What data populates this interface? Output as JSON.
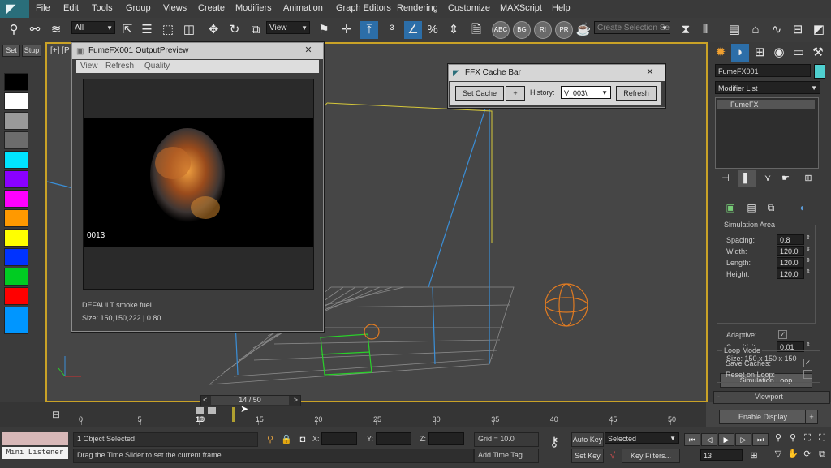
{
  "menubar": {
    "items": [
      "File",
      "Edit",
      "Tools",
      "Group",
      "Views",
      "Create",
      "Modifiers",
      "Animation",
      "Graph Editors",
      "Rendering",
      "Customize",
      "MAXScript",
      "Help"
    ]
  },
  "toolbar": {
    "selection_filter": "All",
    "ref_coord": "View",
    "selection_set_placeholder": "Create Selection Se",
    "render_icons": [
      "ABC",
      "BG",
      "RI",
      "PR",
      "SE"
    ]
  },
  "left_strip": {
    "tab_set": "Set",
    "tab_stup": "Stup",
    "swatches": [
      "#000000",
      "#ffffff",
      "#9a9a9a",
      "#6c6c6c",
      "#00e5ff",
      "#8a00ff",
      "#ff00ff",
      "#ff9900",
      "#ffff00",
      "#0033ff",
      "#00cc22",
      "#ff0000",
      "#0096ff"
    ]
  },
  "viewport": {
    "label": "[+] [P"
  },
  "preview_window": {
    "title": "FumeFX001 OutputPreview",
    "menu": [
      "View",
      "Refresh",
      "Quality"
    ],
    "frame_number": "0013",
    "info_line1": "DEFAULT smoke fuel",
    "info_line2": "Size: 150,150,222 | 0.80"
  },
  "cache_bar": {
    "title": "FFX Cache Bar",
    "set_cache": "Set Cache",
    "plus": "+",
    "history_label": "History:",
    "history_value": "V_003\\",
    "refresh": "Refresh"
  },
  "command_panel": {
    "object_name": "FumeFX001",
    "object_color": "#4fd0d0",
    "modifier_list": "Modifier List",
    "stack_item": "FumeFX",
    "simulation_area_title": "Simulation Area",
    "params": [
      {
        "label": "Spacing:",
        "value": "0.8"
      },
      {
        "label": "Width:",
        "value": "120.0"
      },
      {
        "label": "Length:",
        "value": "120.0"
      },
      {
        "label": "Height:",
        "value": "120.0"
      }
    ],
    "adaptive_label": "Adaptive:",
    "adaptive_checked": true,
    "sensitivity_label": "Sensitivity:",
    "sensitivity_value": "0.01",
    "size_line": "Size: 150 x 150 x 150",
    "simulation_loop": "Simulation Loop",
    "loop_mode_title": "Loop Mode",
    "save_caches": "Save Caches:",
    "reset_on_loop": "Reset on Loop:",
    "viewport_section": "Viewport",
    "enable_display": "Enable Display",
    "enable_display_plus": "+"
  },
  "timeline": {
    "slider_label": "14 / 50",
    "prev": "<",
    "next": ">",
    "frames": [
      "0",
      "5",
      "10",
      "15",
      "20",
      "25",
      "30",
      "35",
      "40",
      "45",
      "50"
    ],
    "current_frame_marker": "13"
  },
  "status": {
    "mini_listener": "Mini Listener",
    "selected_text": "1 Object Selected",
    "prompt_text": "Drag the Time Slider to set the current frame",
    "x_label": "X:",
    "y_label": "Y:",
    "z_label": "Z:",
    "grid": "Grid = 10.0",
    "add_time_tag": "Add Time Tag",
    "auto_key": "Auto Key",
    "set_key": "Set Key",
    "key_mode": "Selected",
    "key_filters": "Key Filters...",
    "current_frame": "13"
  }
}
